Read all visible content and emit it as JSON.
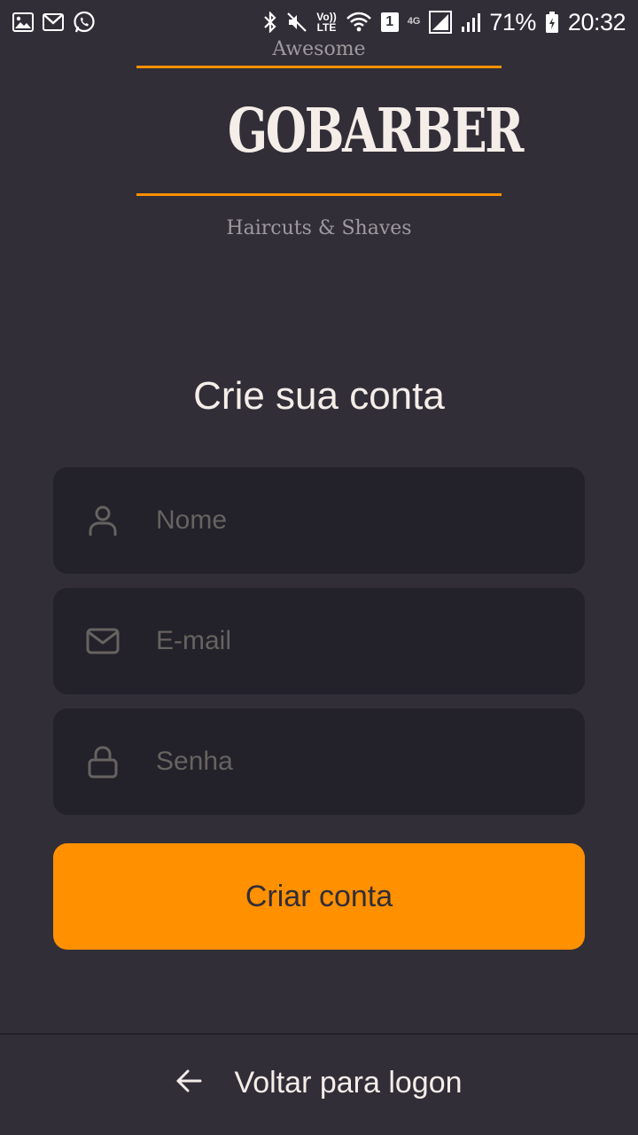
{
  "status_bar": {
    "battery": "71%",
    "time": "20:32",
    "volte_tag": "Vo))\nLTE",
    "network_tag": "4G",
    "sim_badge": "1"
  },
  "logo": {
    "top_text": "Awesome",
    "brand": "GOBARBER",
    "bottom_text": "Haircuts & Shaves",
    "accent_color": "#ff9000"
  },
  "form": {
    "title": "Crie sua conta",
    "name_placeholder": "Nome",
    "email_placeholder": "E-mail",
    "password_placeholder": "Senha",
    "submit_label": "Criar conta"
  },
  "footer": {
    "back_label": "Voltar para logon"
  },
  "icons": {
    "name_field": "user-icon",
    "email_field": "mail-icon",
    "password_field": "lock-icon",
    "back": "arrow-left-icon"
  },
  "colors": {
    "background": "#312e38",
    "input_background": "#232129",
    "primary": "#ff9000",
    "text": "#f4ede8",
    "placeholder": "#666360"
  }
}
